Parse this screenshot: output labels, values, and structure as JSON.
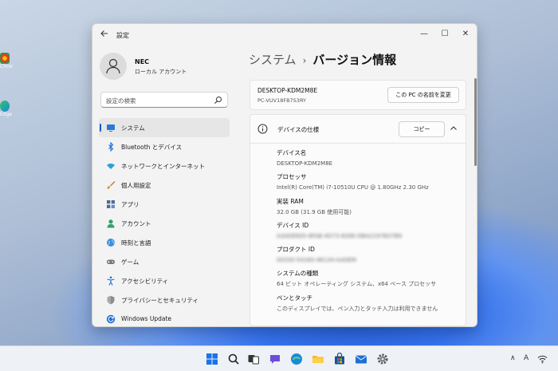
{
  "desktop": {
    "icon1_label": "Chrome",
    "icon2_label": "Edge"
  },
  "window": {
    "app_title": "設定",
    "controls": {
      "minimize": "—",
      "maximize": "☐",
      "close": "✕"
    }
  },
  "profile": {
    "name": "NEC",
    "account_type": "ローカル アカウント"
  },
  "search": {
    "placeholder": "設定の検索"
  },
  "nav": {
    "items": [
      {
        "label": "システム",
        "icon": "system-icon",
        "active": true
      },
      {
        "label": "Bluetooth とデバイス",
        "icon": "bluetooth-icon"
      },
      {
        "label": "ネットワークとインターネット",
        "icon": "wifi-icon"
      },
      {
        "label": "個人用設定",
        "icon": "brush-icon"
      },
      {
        "label": "アプリ",
        "icon": "apps-icon"
      },
      {
        "label": "アカウント",
        "icon": "account-icon"
      },
      {
        "label": "時刻と言語",
        "icon": "globe-icon"
      },
      {
        "label": "ゲーム",
        "icon": "gamepad-icon"
      },
      {
        "label": "アクセシビリティ",
        "icon": "accessibility-icon"
      },
      {
        "label": "プライバシーとセキュリティ",
        "icon": "shield-icon"
      },
      {
        "label": "Windows Update",
        "icon": "update-icon"
      }
    ]
  },
  "breadcrumb": {
    "parent": "システム",
    "separator": "›",
    "current": "バージョン情報"
  },
  "pc_card": {
    "pc_name": "DESKTOP-KDM2M8E",
    "model": "PC-VUV18FB7S3RY",
    "rename_label": "この PC の名前を変更"
  },
  "spec_card": {
    "title": "デバイスの仕様",
    "copy_label": "コピー",
    "rows": [
      {
        "key": "デバイス名",
        "value": "DESKTOP-KDM2M8E",
        "blurred": false
      },
      {
        "key": "プロセッサ",
        "value": "Intel(R) Core(TM) i7-10510U CPU @ 1.80GHz   2.30 GHz",
        "blurred": false
      },
      {
        "key": "実装 RAM",
        "value": "32.0 GB (31.9 GB 使用可能)",
        "blurred": false
      },
      {
        "key": "デバイス ID",
        "value": "A3ADE605-8FAB-4D73-826E-DBA2197B37B9",
        "blurred": true
      },
      {
        "key": "プロダクト ID",
        "value": "00330-54160-46134-AAOEM",
        "blurred": true
      },
      {
        "key": "システムの種類",
        "value": "64 ビット オペレーティング システム、x64 ベース プロセッサ",
        "blurred": false
      },
      {
        "key": "ペンとタッチ",
        "value": "このディスプレイでは、ペン入力とタッチ入力は利用できません",
        "blurred": false
      }
    ]
  },
  "taskbar": {
    "tray_chevron": "∧",
    "tray_ime": "A"
  },
  "colors": {
    "accent": "#0a5bc4",
    "window_bg": "#f3f3f3"
  }
}
